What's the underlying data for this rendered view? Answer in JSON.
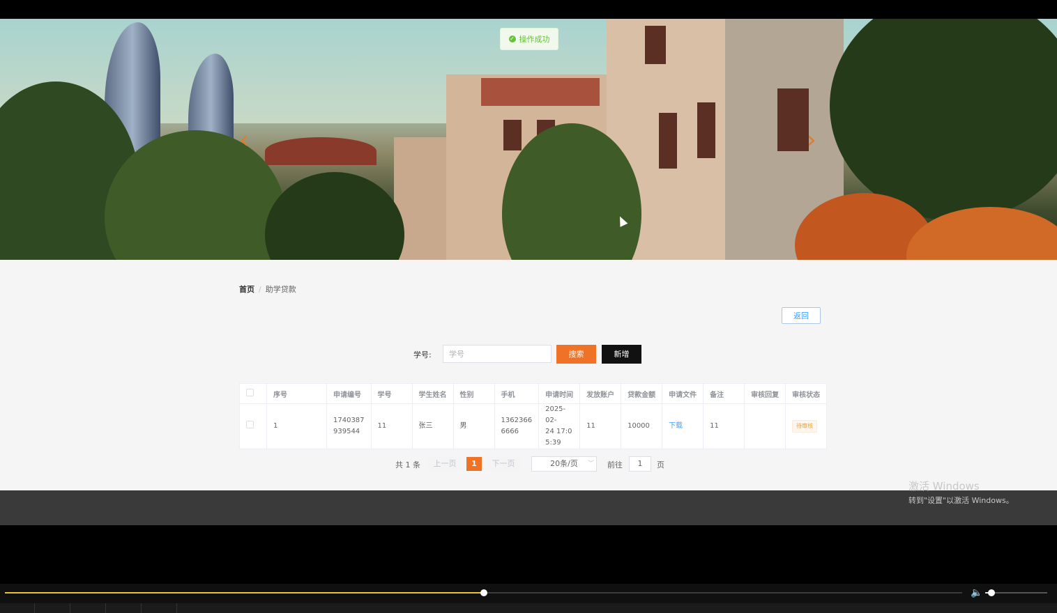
{
  "toast": {
    "text": "操作成功",
    "icon": "check-circle-icon",
    "color": "#67c23a"
  },
  "banner": {
    "prev_icon": "chevron-left-icon",
    "next_icon": "chevron-right-icon",
    "accent": "#e07b2e"
  },
  "breadcrumb": {
    "home": "首页",
    "separator": "/",
    "current": "助学贷款"
  },
  "back_button": "返回",
  "search": {
    "label": "学号:",
    "placeholder": "学号",
    "value": "",
    "search_button": "搜索",
    "add_button": "新增"
  },
  "table": {
    "headers": [
      "序号",
      "申请编号",
      "学号",
      "学生姓名",
      "性别",
      "手机",
      "申请时间",
      "发放账户",
      "贷款金额",
      "申请文件",
      "备注",
      "审核回复",
      "审核状态"
    ],
    "rows": [
      {
        "index": "1",
        "app_no_line1": "1740387",
        "app_no_line2": "939544",
        "student_no": "11",
        "name": "张三",
        "gender": "男",
        "phone_line1": "1362366",
        "phone_line2": "6666",
        "time_line1": "2025-02-",
        "time_line2": "24 17:0",
        "time_line3": "5:39",
        "account": "11",
        "amount": "10000",
        "file": "下载",
        "remark": "11",
        "reply": "",
        "status": "待审核"
      }
    ]
  },
  "pagination": {
    "total": "共 1 条",
    "prev": "上一页",
    "current_page": "1",
    "next": "下一页",
    "page_size": "20条/页",
    "goto_label": "前往",
    "goto_value": "1",
    "page_unit": "页"
  },
  "watermark": {
    "line1": "激活 Windows",
    "line2": "转到\"设置\"以激活 Windows。"
  },
  "player": {
    "progress": 0.5,
    "volume": 0.1,
    "progress_color": "#e8c531",
    "volume_icon": "volume-icon"
  },
  "colors": {
    "primary": "#f07226",
    "dark_button": "#111111",
    "link": "#409eff",
    "warning": "#e6a23c"
  }
}
